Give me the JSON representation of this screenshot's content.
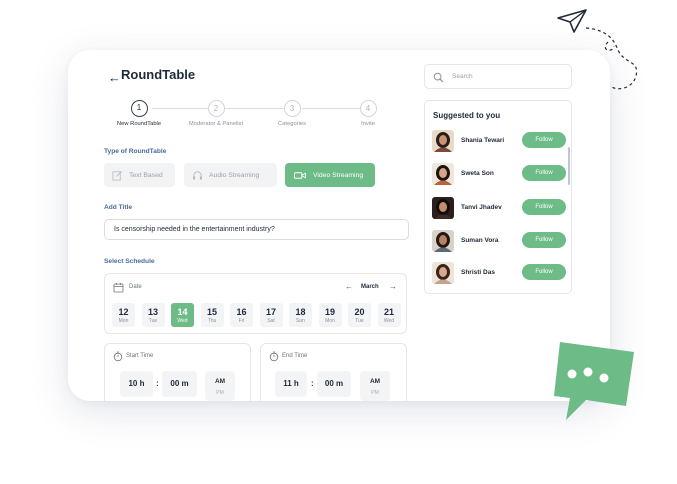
{
  "page": {
    "title": "RoundTable"
  },
  "stepper": [
    {
      "number": "1",
      "label": "New RoundTable",
      "active": true
    },
    {
      "number": "2",
      "label": "Moderator & Panelist",
      "active": false
    },
    {
      "number": "3",
      "label": "Categories",
      "active": false
    },
    {
      "number": "4",
      "label": "Invite",
      "active": false
    }
  ],
  "roundtable_type": {
    "label": "Type of RoundTable",
    "options": [
      {
        "label": "Text Based",
        "icon": "edit-icon",
        "selected": false
      },
      {
        "label": "Audio Streaming",
        "icon": "headphones-icon",
        "selected": false
      },
      {
        "label": "Video Streaming",
        "icon": "video-camera-icon",
        "selected": true
      }
    ]
  },
  "title_field": {
    "label": "Add Title",
    "value": "Is censorship needed in the entertainment industry?"
  },
  "schedule": {
    "label": "Select Schedule",
    "date_label": "Date",
    "month": "March",
    "days": [
      {
        "num": "12",
        "wd": "Mon",
        "selected": false
      },
      {
        "num": "13",
        "wd": "Tue",
        "selected": false
      },
      {
        "num": "14",
        "wd": "Wed",
        "selected": true
      },
      {
        "num": "15",
        "wd": "Thu",
        "selected": false
      },
      {
        "num": "16",
        "wd": "Fri",
        "selected": false
      },
      {
        "num": "17",
        "wd": "Sat",
        "selected": false
      },
      {
        "num": "18",
        "wd": "Sun",
        "selected": false
      },
      {
        "num": "19",
        "wd": "Mon",
        "selected": false
      },
      {
        "num": "20",
        "wd": "Tue",
        "selected": false
      },
      {
        "num": "21",
        "wd": "Wed",
        "selected": false
      }
    ],
    "start_time": {
      "label": "Start Time",
      "hours": "10 h",
      "minutes": "00 m",
      "period": "AM",
      "alt_period": "PM"
    },
    "end_time": {
      "label": "End Time",
      "hours": "11 h",
      "minutes": "00 m",
      "period": "AM",
      "alt_period": "PM"
    }
  },
  "search": {
    "placeholder": "Search"
  },
  "suggestions": {
    "title": "Suggested to you",
    "follow_label": "Follow",
    "people": [
      {
        "name": "Shania Tewari"
      },
      {
        "name": "Sweta Son"
      },
      {
        "name": "Tanvi Jhadev"
      },
      {
        "name": "Suman Vora"
      },
      {
        "name": "Shristi Das"
      }
    ]
  },
  "colors": {
    "accent": "#6dbb86",
    "title": "#1e2a3b",
    "section_label": "#4b6a9b",
    "chip_bg": "#f2f3f5"
  }
}
